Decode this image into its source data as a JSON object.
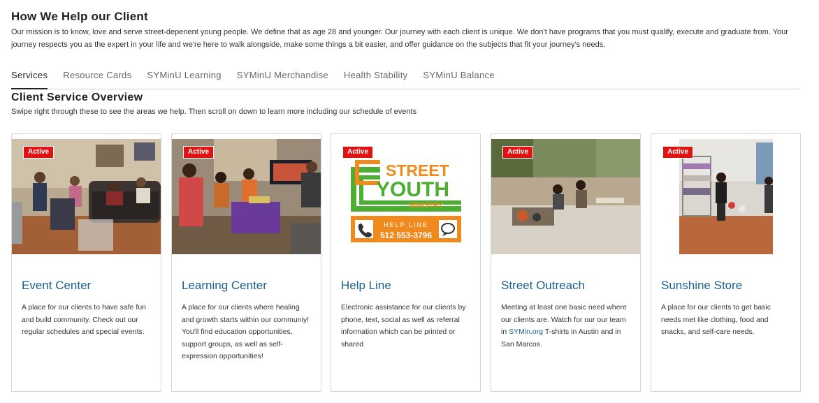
{
  "header": {
    "title": "How We Help our Client",
    "mission": "Our mission is to know, love and serve street-depenent young people. We define that as age 28 and younger. Our journey with each client is unique. We don't have programs that you must qualify, execute and graduate from. Your journey respects you as the expert in your life and we're here to walk alongside, make some things a bit easier, and offer guidance on the subjects that fit your journey's needs."
  },
  "tabs": [
    {
      "label": "Services",
      "active": true
    },
    {
      "label": "Resource Cards",
      "active": false
    },
    {
      "label": "SYMinU Learning",
      "active": false
    },
    {
      "label": "SYMinU Merchandise",
      "active": false
    },
    {
      "label": "Health Stability",
      "active": false
    },
    {
      "label": "SYMinU Balance",
      "active": false
    }
  ],
  "section": {
    "title": "Client Service Overview",
    "subtitle": "Swipe right through these to see the areas we help. Then scroll on down to learn more including our schedule of events"
  },
  "cards": [
    {
      "badge": "Active",
      "title": "Event Center",
      "text": "A place for our clients to have safe fun and build community. Check out our regular schedules and special events."
    },
    {
      "badge": "Active",
      "title": "Learning Center",
      "text": "A place for our clients where healing and growth starts within our communiy! You'll find education opportunities, support groups, as well as self-expression opportunities!"
    },
    {
      "badge": "Active",
      "title": "Help Line",
      "text": "Electronic assistance for our clients by phone, text, social as well as referral information which can be printed or shared"
    },
    {
      "badge": "Active",
      "title": "Street Outreach",
      "text_before": "Meeting at least one basic need where our clients are. Watch for our our team in ",
      "link": "SYMin.org",
      "text_after": " T-shirts in Austin and in San Marcos."
    },
    {
      "badge": "Active",
      "title": "Sunshine Store",
      "text": "A place for our clients to get basic needs met like clothing, food and snacks, and self-care needs."
    }
  ],
  "logo": {
    "line1": "STREET",
    "line2": "YOUTH",
    "line3": "MINISTRY",
    "helpline_label": "HELP LINE",
    "phone": "512 553-3796"
  },
  "colors": {
    "badge": "#e01313",
    "card_title": "#1d5f8c",
    "logo_orange": "#f08a1c",
    "logo_green": "#4caf32"
  }
}
